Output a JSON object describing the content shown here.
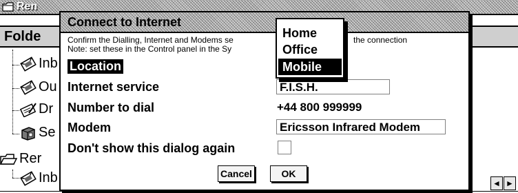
{
  "background_window": {
    "title": "Ren",
    "folder_label": "Folde",
    "tree_items": [
      {
        "label": "Inb"
      },
      {
        "label": "Ou"
      },
      {
        "label": "Dr"
      },
      {
        "label": "Se"
      }
    ],
    "sub_folder_label": "Rer",
    "sub_item_label": "Inb",
    "scroll_left": "◄",
    "scroll_right": "►"
  },
  "dialog": {
    "title": "Connect to Internet",
    "note_line1": "Confirm the Dialling, Internet and Modems se",
    "note_line1_tail": "the connection",
    "note_line2": "Note: set these in the Control panel in the Sy",
    "rows": {
      "location_label": "Location",
      "internet_service_label": "Internet service",
      "internet_service_value": "F.I.S.H.",
      "number_label": "Number to dial",
      "number_value": "+44 800 999999",
      "modem_label": "Modem",
      "modem_value": "Ericsson Infrared Modem",
      "dont_show_label": "Don't show this dialog again",
      "dont_show_checked": false
    },
    "buttons": {
      "cancel": "Cancel",
      "ok": "OK"
    }
  },
  "location_popup": {
    "options": [
      "Home",
      "Office",
      "Mobile"
    ],
    "selected": "Mobile"
  }
}
